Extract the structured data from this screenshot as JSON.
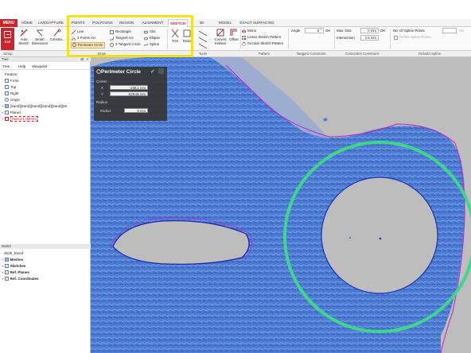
{
  "tabs": {
    "menu": "MENU",
    "items": [
      "HOME",
      "LIVECAPTURE",
      "POINTS",
      "POLYGONS",
      "REGION",
      "ALIGNMENT",
      "SKETCH",
      "3D SKETCH",
      "MODEL",
      "EXACT SURFACING"
    ],
    "active": "SKETCH"
  },
  "ribbon": {
    "exit_label": "Exit",
    "setup_big": [
      "Auto Sketch",
      "Smart Dimension",
      "Constra..."
    ],
    "draw_col1": [
      "Line",
      "3 Points Arc",
      "Perimeter Circle"
    ],
    "draw_col2": [
      "Rectangle",
      "Tangent Arc",
      "3 Tangent Circle"
    ],
    "draw_col3": [
      "Slot",
      "Ellipse",
      "Spline"
    ],
    "tools_big": [
      "Trim",
      "Resiz",
      "Convert Entities",
      "Offset"
    ],
    "pattern_items": [
      "Mirror",
      "Linear Sketch Pattern",
      "Circular Sketch Pattern"
    ],
    "tangent": {
      "label": "Angle",
      "value": "5 °",
      "ok": "OK"
    },
    "coincident": {
      "label1": "Max. Dist.",
      "value1": "0 mm",
      "label2": "Intersection",
      "value2": "2.5 mm",
      "ok": "OK"
    },
    "rebuild": {
      "label": "No. Of Spline Points",
      "value": "",
      "sub": "Define Spline Points",
      "ok": "OK"
    },
    "groups": [
      "Setup",
      "Draw",
      "Tools",
      "Pattern",
      "Tangent Constraint",
      "Coincident Constraint",
      "Rebuild Spline"
    ]
  },
  "tree_panel": {
    "header": "Tree",
    "tabs": [
      "Tree",
      "Help",
      "Viewpoint"
    ],
    "feature_label": "Feature",
    "items": [
      "Front",
      "Top",
      "Right",
      "Origin",
      "[Sand][Sand][Sand][Sand][Sand][Se",
      "Plane1",
      "Sketch1 (Mesh)"
    ]
  },
  "model_panel": {
    "header": "Model",
    "items": [
      "Sloth_friend",
      "Meshes",
      "Sketches",
      "Ref. Planes",
      "Ref. Coordinates"
    ]
  },
  "dialog": {
    "title": "Perimeter Circle",
    "center_label": "Center",
    "x_label": "X",
    "x_value": "-248.1 mm",
    "y_label": "Y",
    "y_value": "-529.65 mm",
    "radius_label": "Radius",
    "radius_field_label": "Radius",
    "radius_value": "0 mm"
  },
  "colors": {
    "accent_red": "#c8262c",
    "mesh_blue": "#4f7fd6",
    "highlight_yellow": "#f3e21a",
    "highlight_green": "#3fd68a",
    "sketch_magenta": "#c21fc9",
    "circle_blue": "#2030b0"
  }
}
